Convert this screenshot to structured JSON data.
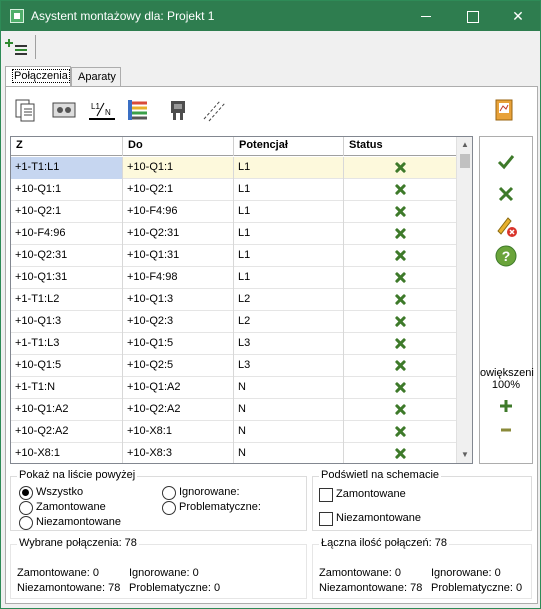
{
  "window": {
    "title": "Asystent montażowy dla: Projekt 1"
  },
  "tabs": [
    "Połączenia",
    "Aparaty"
  ],
  "toolbar_icons": [
    "copy-document-icon",
    "terminal-block-icon",
    "l1-n-wire-icon",
    "color-wires-icon",
    "connector-icon",
    "diagonal-lines-icon"
  ],
  "report_icon": "report-book-icon",
  "table": {
    "columns": [
      "Z",
      "Do",
      "Potencjał",
      "Status"
    ],
    "rows": [
      {
        "z": "+1-T1:L1",
        "do": "+10-Q1:1",
        "pot": "L1"
      },
      {
        "z": "+10-Q1:1",
        "do": "+10-Q2:1",
        "pot": "L1"
      },
      {
        "z": "+10-Q2:1",
        "do": "+10-F4:96",
        "pot": "L1"
      },
      {
        "z": "+10-F4:96",
        "do": "+10-Q2:31",
        "pot": "L1"
      },
      {
        "z": "+10-Q2:31",
        "do": "+10-Q1:31",
        "pot": "L1"
      },
      {
        "z": "+10-Q1:31",
        "do": "+10-F4:98",
        "pot": "L1"
      },
      {
        "z": "+1-T1:L2",
        "do": "+10-Q1:3",
        "pot": "L2"
      },
      {
        "z": "+10-Q1:3",
        "do": "+10-Q2:3",
        "pot": "L2"
      },
      {
        "z": "+1-T1:L3",
        "do": "+10-Q1:5",
        "pot": "L3"
      },
      {
        "z": "+10-Q1:5",
        "do": "+10-Q2:5",
        "pot": "L3"
      },
      {
        "z": "+1-T1:N",
        "do": "+10-Q1:A2",
        "pot": "N"
      },
      {
        "z": "+10-Q1:A2",
        "do": "+10-Q2:A2",
        "pot": "N"
      },
      {
        "z": "+10-Q2:A2",
        "do": "+10-X8:1",
        "pot": "N"
      },
      {
        "z": "+10-X8:1",
        "do": "+10-X8:3",
        "pot": "N"
      }
    ]
  },
  "side": {
    "zoom_label": "owiększeni",
    "zoom_value": "100%",
    "buttons": [
      "check-icon",
      "x-icon",
      "edit-delete-icon",
      "help-icon",
      "plus-icon",
      "minus-icon"
    ]
  },
  "filter": {
    "title": "Pokaż na liście powyżej",
    "all": "Wszystko",
    "mounted": "Zamontowane",
    "unmounted": "Niezamontowane",
    "ignored": "Ignorowane:",
    "problematic": "Problematyczne:"
  },
  "highlight": {
    "title": "Podświetl na schemacie",
    "mounted": "Zamontowane",
    "unmounted": "Niezamontowane"
  },
  "selected": {
    "title": "Wybrane połączenia: 78",
    "mounted": "Zamontowane: 0",
    "ignored": "Ignorowane: 0",
    "unmounted": "Niezamontowane: 78",
    "problematic": "Problematyczne: 0"
  },
  "total": {
    "title": "Łączna ilość połączeń: 78",
    "mounted": "Zamontowane: 0",
    "ignored": "Ignorowane: 0",
    "unmounted": "Niezamontowane: 78",
    "problematic": "Problematyczne: 0"
  },
  "colors": {
    "titlebar": "#2e7d4f",
    "selected_row": "#fdf9dc",
    "selected_cell": "#c6d6f0",
    "status_mark": "#3e7a2a"
  }
}
